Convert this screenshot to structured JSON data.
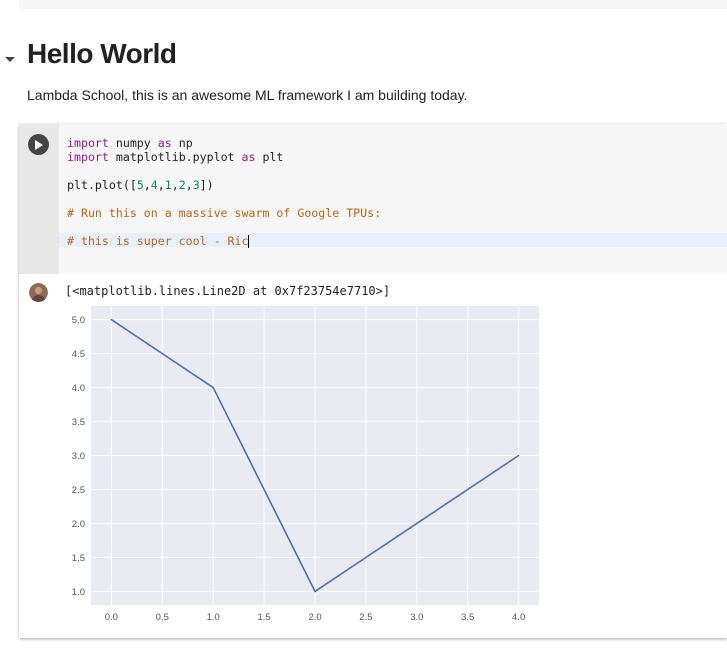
{
  "section": {
    "title": "Hello World"
  },
  "text_cell": {
    "content": "Lambda School, this is an awesome ML framework I am building today."
  },
  "code": {
    "line1": {
      "kw1": "import",
      "name": " numpy ",
      "kw2": "as",
      "alias": " np"
    },
    "line2": {
      "kw1": "import",
      "name": " matplotlib.pyplot ",
      "kw2": "as",
      "alias": " plt"
    },
    "line3": {
      "pre": "plt.plot([",
      "v1": "5",
      "c1": ",",
      "v2": "4",
      "c2": ",",
      "v3": "1",
      "c3": ",",
      "v4": "2",
      "c4": ",",
      "v5": "3",
      "post": "])"
    },
    "line4": "# Run this on a massive swarm of Google TPUs:",
    "line5": "# this is super cool - Ric"
  },
  "output": {
    "repr": "[<matplotlib.lines.Line2D at 0x7f23754e7710>]"
  },
  "icons": {
    "run": "play-icon",
    "toggle": "caret-down-icon",
    "avatar": "user-avatar-icon"
  },
  "colors": {
    "line": "#4c72b0",
    "plot_bg": "#eaeaf2",
    "comment": "#b5651d",
    "keyword": "#8a1f8a",
    "number": "#098658"
  },
  "chart_data": {
    "type": "line",
    "x": [
      0,
      1,
      2,
      3,
      4
    ],
    "y": [
      5,
      4,
      1,
      2,
      3
    ],
    "xlim": [
      -0.2,
      4.2
    ],
    "ylim": [
      0.8,
      5.2
    ],
    "xticks": [
      "0.0",
      "0.5",
      "1.0",
      "1.5",
      "2.0",
      "2.5",
      "3.0",
      "3.5",
      "4.0"
    ],
    "yticks": [
      "1.0",
      "1.5",
      "2.0",
      "2.5",
      "3.0",
      "3.5",
      "4.0",
      "4.5",
      "5.0"
    ],
    "grid": true,
    "title": "",
    "xlabel": "",
    "ylabel": ""
  }
}
